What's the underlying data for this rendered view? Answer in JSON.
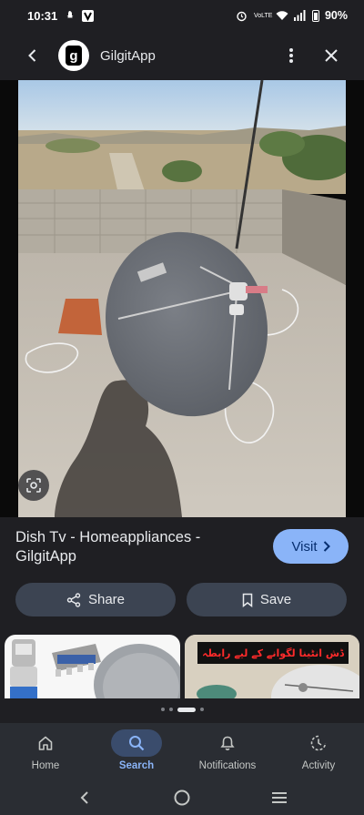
{
  "status_bar": {
    "time": "10:31",
    "network": "VoLTE",
    "battery": "90%"
  },
  "header": {
    "site_name": "GilgitApp",
    "logo_letter": "g"
  },
  "result": {
    "title": "Dish Tv - Homeappliances - GilgitApp",
    "visit_label": "Visit",
    "share_label": "Share",
    "save_label": "Save"
  },
  "related": {
    "thumb2_caption": "ڈش انٹینا لگوانے کے لیے رابطہ"
  },
  "bottom_nav": {
    "items": [
      {
        "label": "Home",
        "icon": "home-icon"
      },
      {
        "label": "Search",
        "icon": "search-icon",
        "active": true
      },
      {
        "label": "Notifications",
        "icon": "bell-icon"
      },
      {
        "label": "Activity",
        "icon": "activity-icon"
      }
    ]
  },
  "colors": {
    "background": "#1f1f23",
    "accent": "#8ab4f8",
    "button": "#3c4452"
  }
}
